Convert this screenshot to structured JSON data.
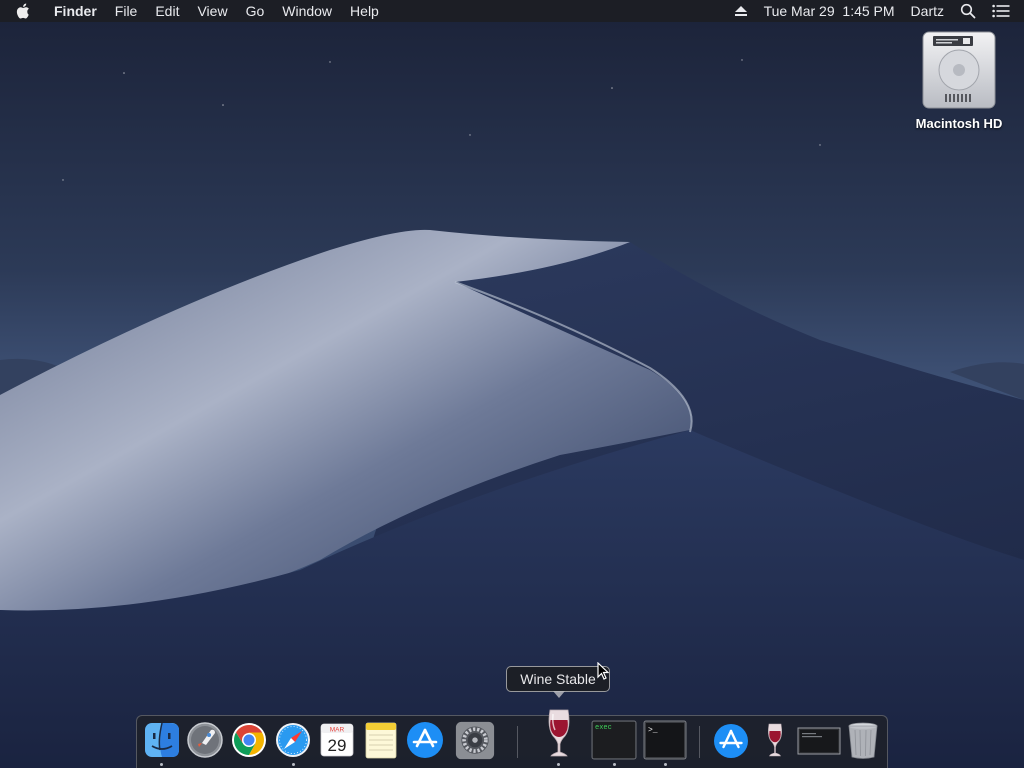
{
  "menubar": {
    "apple_icon": "apple-logo-icon",
    "app_name": "Finder",
    "items": [
      "File",
      "Edit",
      "View",
      "Go",
      "Window",
      "Help"
    ],
    "eject_icon": "eject-icon",
    "clock": "Tue Mar 29  1:45 PM",
    "user": "Dartz",
    "search_icon": "spotlight-search-icon",
    "list_icon": "notification-center-icon"
  },
  "desktop": {
    "drive_label": "Macintosh HD"
  },
  "dock": {
    "tooltip": "Wine Stable",
    "items": [
      {
        "name": "Finder",
        "icon": "finder-icon",
        "running": true
      },
      {
        "name": "Launchpad",
        "icon": "launchpad-icon",
        "running": false
      },
      {
        "name": "Google Chrome",
        "icon": "chrome-icon",
        "running": false
      },
      {
        "name": "Safari",
        "icon": "safari-icon",
        "running": true
      },
      {
        "name": "Calendar",
        "icon": "calendar-icon",
        "running": false,
        "month": "MAR",
        "day": "29"
      },
      {
        "name": "Notes",
        "icon": "notes-icon",
        "running": false
      },
      {
        "name": "App Store",
        "icon": "app-store-icon",
        "running": false
      },
      {
        "name": "System Preferences",
        "icon": "system-preferences-icon",
        "running": false
      },
      {
        "name": "Wine Stable",
        "icon": "wine-icon",
        "running": true
      },
      {
        "name": "exec",
        "icon": "exec-terminal-icon",
        "running": true,
        "text": "exec"
      },
      {
        "name": "Terminal",
        "icon": "terminal-icon",
        "running": true,
        "text": ">_"
      },
      {
        "name": "App Store (folder)",
        "icon": "app-store-icon",
        "running": false
      },
      {
        "name": "Wine",
        "icon": "wine-icon",
        "running": false
      },
      {
        "name": "Window preview",
        "icon": "window-preview-icon",
        "running": false
      },
      {
        "name": "Trash",
        "icon": "trash-icon",
        "running": false
      }
    ]
  },
  "colors": {
    "menubar_bg": "#1c1e24",
    "sky_top": "#1c2740",
    "sky_bottom": "#3d5172",
    "dune_light": "#a9b1c4",
    "dune_dark": "#202b47"
  }
}
